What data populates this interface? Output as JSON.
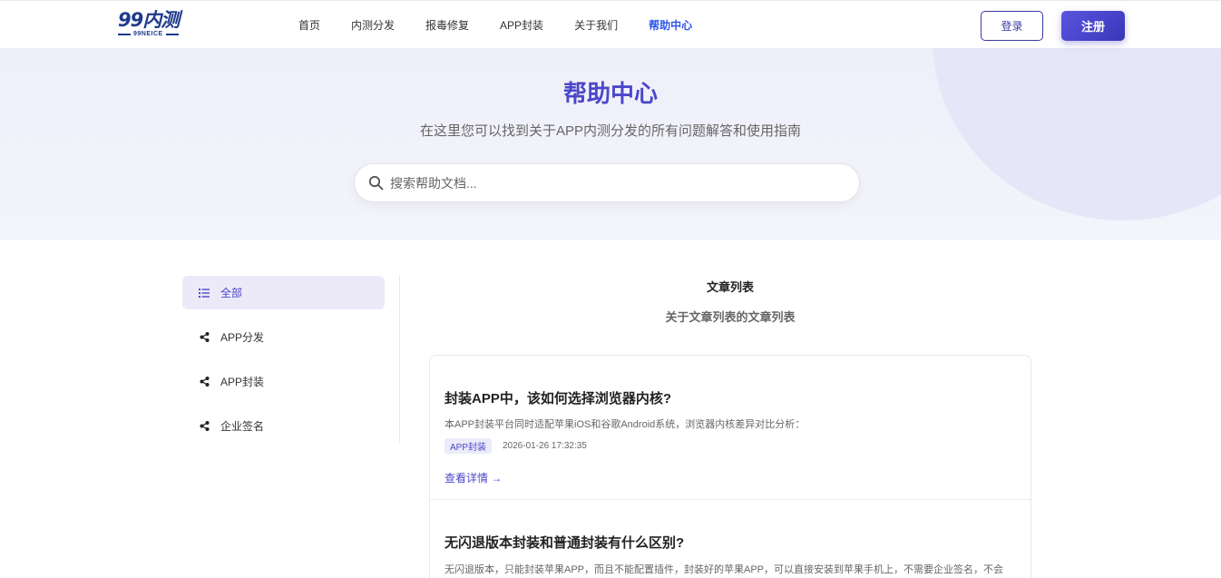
{
  "header": {
    "logo_mark": "99内测",
    "logo_sub": "99NEICE",
    "nav": [
      "首页",
      "内测分发",
      "报毒修复",
      "APP封装",
      "关于我们",
      "帮助中心"
    ],
    "active_nav": "帮助中心",
    "login_label": "登录",
    "register_label": "注册"
  },
  "hero": {
    "title": "帮助中心",
    "subtitle": "在这里您可以找到关于APP内测分发的所有问题解答和使用指南",
    "search_placeholder": "搜索帮助文档..."
  },
  "sidebar": {
    "items": [
      {
        "label": "全部",
        "icon": "list-icon",
        "active": true
      },
      {
        "label": "APP分发",
        "icon": "share-icon",
        "active": false
      },
      {
        "label": "APP封装",
        "icon": "share-icon",
        "active": false
      },
      {
        "label": "企业签名",
        "icon": "share-icon",
        "active": false
      }
    ]
  },
  "main": {
    "list_title": "文章列表",
    "list_subtitle": "关于文章列表的文章列表",
    "articles": [
      {
        "title": "封装APP中，该如何选择浏览器内核?",
        "desc": "本APP封装平台同时适配苹果iOS和谷歌Android系统，浏览器内核差异对比分析：",
        "tag": "APP封装",
        "time": "2026-01-26 17:32:35",
        "more": "查看详情 →"
      },
      {
        "title": "无闪退版本封装和普通封装有什么区别?",
        "desc": "无闪退版本，只能封装苹果APP，而且不能配置插件，封装好的苹果APP，可以直接安装到苹果手机上，不需要企业签名，不会"
      }
    ]
  },
  "colors": {
    "accent": "#4b47c9",
    "nav_active": "#2f54eb",
    "logo": "#1f3a8a"
  }
}
